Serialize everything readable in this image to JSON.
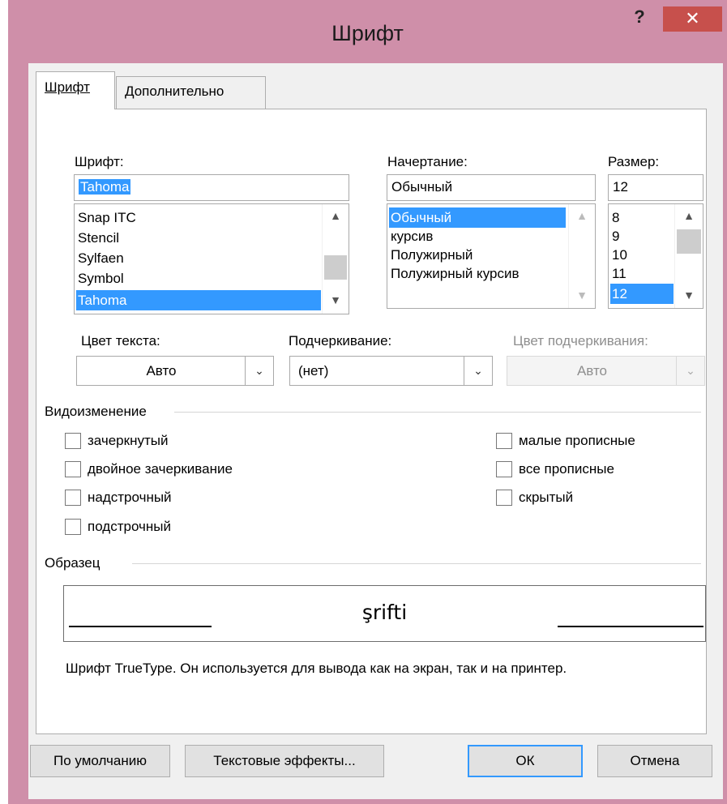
{
  "window": {
    "title": "Шрифт",
    "help": "?",
    "close": "✕"
  },
  "tabs": [
    {
      "label": "Шрифт",
      "active": true
    },
    {
      "label": "Дополнительно",
      "active": false
    }
  ],
  "font": {
    "label": "Шрифт:",
    "value": "Tahoma",
    "items": [
      "Snap ITC",
      "Stencil",
      "Sylfaen",
      "Symbol",
      "Tahoma"
    ],
    "selected": "Tahoma"
  },
  "style": {
    "label": "Начертание:",
    "value": "Обычный",
    "items": [
      "Обычный",
      "курсив",
      "Полужирный",
      "Полужирный курсив"
    ],
    "selected": "Обычный"
  },
  "size": {
    "label": "Размер:",
    "value": "12",
    "items": [
      "8",
      "9",
      "10",
      "11",
      "12"
    ],
    "selected": "12"
  },
  "text_color": {
    "label": "Цвет текста:",
    "value": "Авто"
  },
  "underline": {
    "label": "Подчеркивание:",
    "value": "(нет)"
  },
  "underline_color": {
    "label": "Цвет подчеркивания:",
    "value": "Авто",
    "enabled": false
  },
  "effects": {
    "label": "Видоизменение",
    "left": [
      {
        "label": "зачеркнутый",
        "checked": false
      },
      {
        "label": "двойное зачеркивание",
        "checked": false
      },
      {
        "label": "надстрочный",
        "checked": false
      },
      {
        "label": "подстрочный",
        "checked": false
      }
    ],
    "right": [
      {
        "label": "малые прописные",
        "checked": false
      },
      {
        "label": "все прописные",
        "checked": false
      },
      {
        "label": "скрытый",
        "checked": false
      }
    ]
  },
  "preview": {
    "label": "Образец",
    "sample": "şrifti",
    "description": "Шрифт TrueType. Он используется для вывода как на экран, так и на принтер."
  },
  "buttons": {
    "default": "По умолчанию",
    "text_effects": "Текстовые эффекты...",
    "ok": "ОК",
    "cancel": "Отмена"
  },
  "colors": {
    "titlebar": "#cf8fa9",
    "close": "#c7504c",
    "selection": "#3399ff",
    "dialog_bg": "#f0f0f0"
  }
}
